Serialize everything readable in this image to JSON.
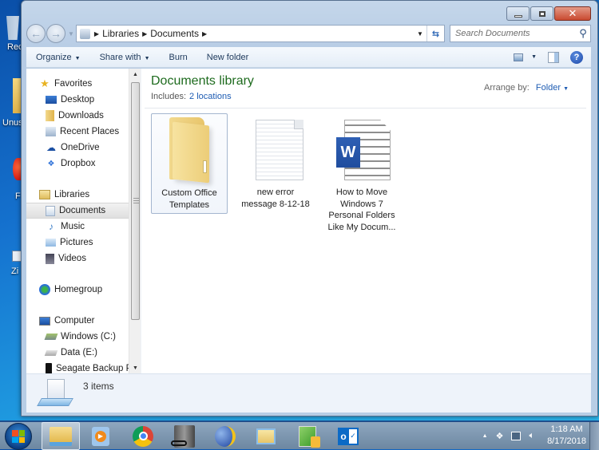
{
  "desktop": {
    "icons": [
      {
        "label": "Rec",
        "icon": "recycle-bin-icon"
      },
      {
        "label": "Unus",
        "icon": "folder-icon"
      },
      {
        "label": "F",
        "icon": "app-shortcut-icon"
      },
      {
        "label": "Zi",
        "icon": "app-shortcut-icon"
      }
    ]
  },
  "window": {
    "caption": {
      "minimize": "minimize",
      "maximize": "maximize",
      "close": "close"
    },
    "address": {
      "segments": [
        "Libraries",
        "Documents"
      ],
      "icon": "libraries-icon"
    },
    "search": {
      "placeholder": "Search Documents"
    },
    "toolbar": {
      "organize": "Organize",
      "share_with": "Share with",
      "burn": "Burn",
      "new_folder": "New folder"
    },
    "nav_pane": {
      "items": [
        {
          "label": "Favorites",
          "icon": "star-icon",
          "level": 1
        },
        {
          "label": "Desktop",
          "icon": "desktop-icon",
          "level": 2
        },
        {
          "label": "Downloads",
          "icon": "downloads-icon",
          "level": 2
        },
        {
          "label": "Recent Places",
          "icon": "recent-places-icon",
          "level": 2
        },
        {
          "label": "OneDrive",
          "icon": "onedrive-icon",
          "level": 2
        },
        {
          "label": "Dropbox",
          "icon": "dropbox-icon",
          "level": 2
        },
        {
          "label": "Libraries",
          "icon": "libraries-icon",
          "level": 1
        },
        {
          "label": "Documents",
          "icon": "documents-icon",
          "level": 2,
          "selected": true
        },
        {
          "label": "Music",
          "icon": "music-icon",
          "level": 2
        },
        {
          "label": "Pictures",
          "icon": "pictures-icon",
          "level": 2
        },
        {
          "label": "Videos",
          "icon": "videos-icon",
          "level": 2
        },
        {
          "label": "Homegroup",
          "icon": "homegroup-icon",
          "level": 1
        },
        {
          "label": "Computer",
          "icon": "computer-icon",
          "level": 1
        },
        {
          "label": "Windows (C:)",
          "icon": "drive-c-icon",
          "level": 2
        },
        {
          "label": "Data (E:)",
          "icon": "drive-e-icon",
          "level": 2
        },
        {
          "label": "Seagate Backup P",
          "icon": "external-drive-icon",
          "level": 2
        }
      ]
    },
    "library": {
      "title": "Documents library",
      "includes_label": "Includes:",
      "includes_link": "2 locations",
      "arrange_label": "Arrange by:",
      "arrange_value": "Folder"
    },
    "files": [
      {
        "name": "Custom Office Templates",
        "type": "folder",
        "selected": true
      },
      {
        "name": "new error message 8-12-18",
        "type": "text"
      },
      {
        "name": "How to Move Windows 7 Personal Folders Like My Docum...",
        "type": "word"
      }
    ],
    "details": {
      "count": "3 items"
    }
  },
  "taskbar": {
    "apps": [
      {
        "name": "windows-explorer",
        "active": true
      },
      {
        "name": "media-player"
      },
      {
        "name": "chrome"
      },
      {
        "name": "server-tool"
      },
      {
        "name": "globe-browser"
      },
      {
        "name": "folder-app"
      },
      {
        "name": "spreadsheet-app"
      },
      {
        "name": "outlook"
      }
    ],
    "clock": {
      "time": "1:18 AM",
      "date": "8/17/2018"
    }
  }
}
